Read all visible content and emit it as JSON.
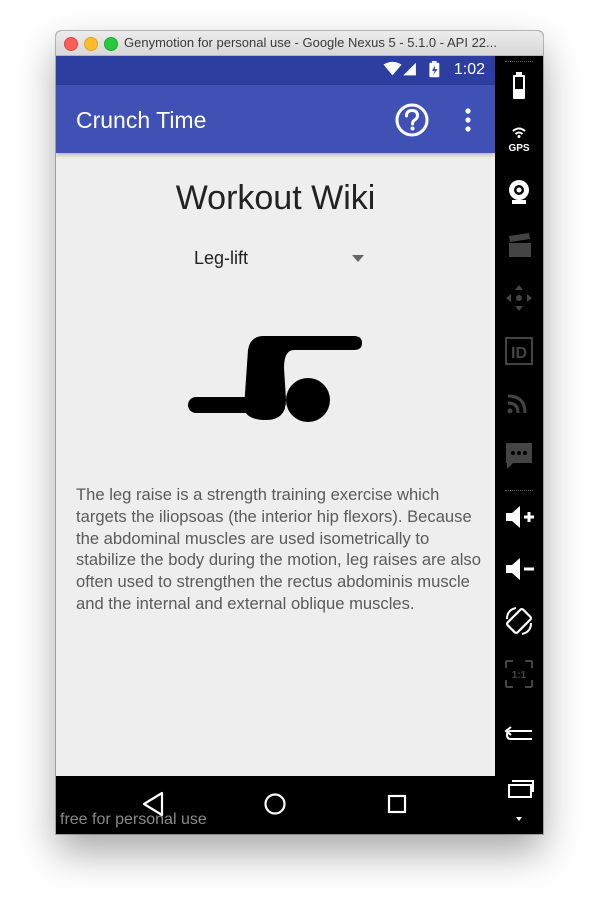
{
  "window": {
    "title": "Genymotion for personal use - Google Nexus 5 - 5.1.0 - API 22..."
  },
  "statusbar": {
    "time": "1:02"
  },
  "appbar": {
    "title": "Crunch Time"
  },
  "page": {
    "heading": "Workout Wiki",
    "spinner_value": "Leg-lift",
    "description": "The leg raise is a strength training exercise which targets the iliopsoas (the interior hip flexors). Because the abdominal muscles are used isometrically to stabilize the body during the motion, leg raises are also often used to strengthen the rectus abdominis muscle and the internal and external oblique muscles."
  },
  "watermark": "free for personal use",
  "sidebar": {
    "gps_label": "GPS",
    "id_label": "ID",
    "pixel_ratio_label": "1:1"
  },
  "colors": {
    "appbar": "#3f51b5",
    "statusbar": "#2c3e9f",
    "background": "#eeeeee"
  }
}
